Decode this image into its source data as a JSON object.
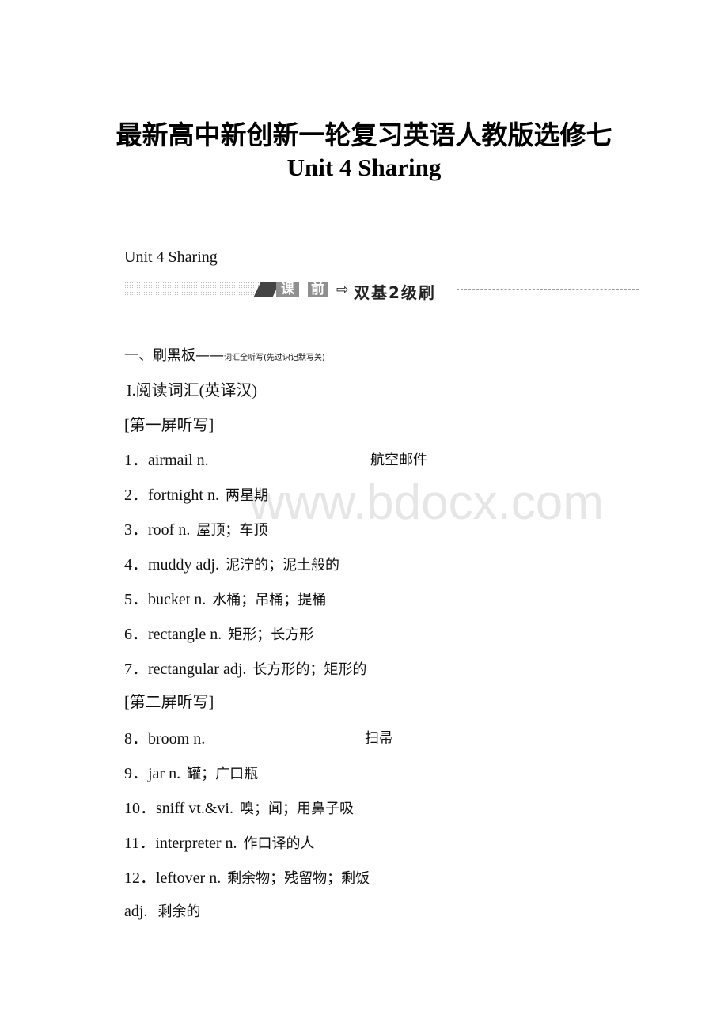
{
  "document": {
    "title_line1": "最新高中新创新一轮复习英语人教版选修七",
    "title_line2": "Unit 4 Sharing",
    "unit_heading": "Unit 4 Sharing",
    "banner": {
      "tag1": "课",
      "tag2": "前",
      "arrow": "⇨",
      "subtitle": "双基2级刷"
    },
    "section_heading": {
      "main": "一、刷黑板——",
      "note": "词汇全听写(先过识记默写关)"
    },
    "part_heading": "I.阅读词汇(英译汉)",
    "screen1_label": "[第一屏听写]",
    "screen2_label": "[第二屏听写]",
    "items": [
      {
        "num": "1．",
        "word": "airmail n.",
        "meaning": "航空邮件"
      },
      {
        "num": "2．",
        "word": "fortnight n.",
        "meaning": "两星期"
      },
      {
        "num": "3．",
        "word": "roof n.",
        "meaning": "屋顶；车顶"
      },
      {
        "num": "4．",
        "word": "muddy adj.",
        "meaning": "泥泞的；泥土般的"
      },
      {
        "num": "5．",
        "word": "bucket n.",
        "meaning": "水桶；吊桶；提桶"
      },
      {
        "num": "6．",
        "word": "rectangle n.",
        "meaning": "矩形；长方形"
      },
      {
        "num": "7．",
        "word": "rectangular adj.",
        "meaning": "长方形的；矩形的"
      },
      {
        "num": "8．",
        "word": "broom n.",
        "meaning": "扫帚"
      },
      {
        "num": "9．",
        "word": "jar n.",
        "meaning": "罐；广口瓶"
      },
      {
        "num": "10．",
        "word": "sniff vt.&vi.",
        "meaning": "嗅；闻；用鼻子吸"
      },
      {
        "num": "11．",
        "word": "interpreter n.",
        "meaning": "作口译的人"
      },
      {
        "num": "12．",
        "word": "leftover n.",
        "meaning": "剩余物；残留物；剩饭"
      }
    ],
    "continuation": {
      "word": "adj.",
      "meaning": "剩余的"
    },
    "watermark": "www.bdocx.com"
  }
}
